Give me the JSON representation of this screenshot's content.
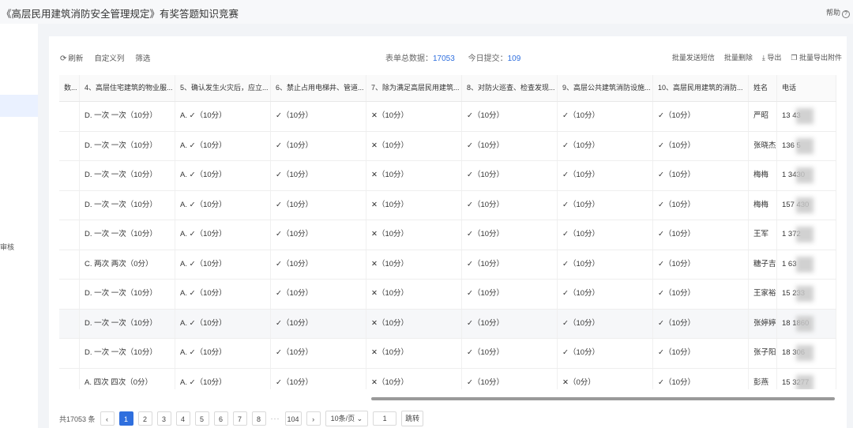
{
  "header": {
    "title": "《高层民用建筑消防安全管理规定》有奖答题知识竞赛",
    "help_label": "帮助",
    "help_icon": "help-circle-icon"
  },
  "left_nav": {
    "partial_label": "审核"
  },
  "toolbar": {
    "refresh_label": "刷新",
    "custom_columns_label": "自定义列",
    "filter_label": "筛选",
    "total_label": "表单总数据：",
    "total_value": "17053",
    "today_label": "今日提交：",
    "today_value": "109",
    "sms_label": "批量发送短信",
    "batch_delete_label": "批量删除",
    "export_label": "导出",
    "batch_export_attach_label": "批量导出附件"
  },
  "table": {
    "headers": [
      "数...",
      "4、高层住宅建筑的物业服...",
      "5、确认发生火灾后，应立...",
      "6、禁止占用电梯井、管道...",
      "7、除为满足高层民用建筑...",
      "8、对防火巡查、检查发现...",
      "9、高层公共建筑消防设施...",
      "10、高层民用建筑的消防...",
      "姓名",
      "电话"
    ],
    "rows": [
      [
        "",
        "D. 一次 一次（10分）",
        "A. ✓（10分）",
        "✓（10分）",
        "✕（10分）",
        "✓（10分）",
        "✓（10分）",
        "✓（10分）",
        "严昭",
        "13        43"
      ],
      [
        "",
        "D. 一次 一次（10分）",
        "A. ✓（10分）",
        "✓（10分）",
        "✕（10分）",
        "✓（10分）",
        "✓（10分）",
        "✓（10分）",
        "张晓杰",
        "136        5"
      ],
      [
        "",
        "D. 一次 一次（10分）",
        "A. ✓（10分）",
        "✓（10分）",
        "✕（10分）",
        "✓（10分）",
        "✓（10分）",
        "✓（10分）",
        "梅梅",
        "1        3430"
      ],
      [
        "",
        "D. 一次 一次（10分）",
        "A. ✓（10分）",
        "✓（10分）",
        "✕（10分）",
        "✓（10分）",
        "✓（10分）",
        "✓（10分）",
        "梅梅",
        "157        430"
      ],
      [
        "",
        "D. 一次 一次（10分）",
        "A. ✓（10分）",
        "✓（10分）",
        "✕（10分）",
        "✓（10分）",
        "✓（10分）",
        "✓（10分）",
        "王军",
        "1        372"
      ],
      [
        "",
        "C. 两次 两次（0分）",
        "A. ✓（10分）",
        "✓（10分）",
        "✕（10分）",
        "✓（10分）",
        "✓（10分）",
        "✓（10分）",
        "糖子吉",
        "1        63"
      ],
      [
        "",
        "D. 一次 一次（10分）",
        "A. ✓（10分）",
        "✓（10分）",
        "✕（10分）",
        "✓（10分）",
        "✓（10分）",
        "✓（10分）",
        "王家裕",
        "15        233"
      ],
      [
        "",
        "D. 一次 一次（10分）",
        "A. ✓（10分）",
        "✓（10分）",
        "✕（10分）",
        "✓（10分）",
        "✓（10分）",
        "✓（10分）",
        "张婷婷",
        "18        1860"
      ],
      [
        "",
        "D. 一次 一次（10分）",
        "A. ✓（10分）",
        "✓（10分）",
        "✕（10分）",
        "✓（10分）",
        "✓（10分）",
        "✓（10分）",
        "张子阳",
        "18        306"
      ],
      [
        "",
        "A. 四次 四次（0分）",
        "A. ✓（10分）",
        "✓（10分）",
        "✕（10分）",
        "✓（10分）",
        "✕（0分）",
        "✓（10分）",
        "彭燕",
        "15        3277"
      ]
    ]
  },
  "pagination": {
    "total_label": "共17053 条",
    "prev": "‹",
    "pages": [
      "1",
      "2",
      "3",
      "4",
      "5",
      "6",
      "7",
      "8"
    ],
    "ellipsis": "···",
    "last_page": "104",
    "next": "›",
    "page_size": "10条/页",
    "jump_value": "1",
    "jump_label": "跳转"
  },
  "colors": {
    "accent": "#2f6fde"
  }
}
